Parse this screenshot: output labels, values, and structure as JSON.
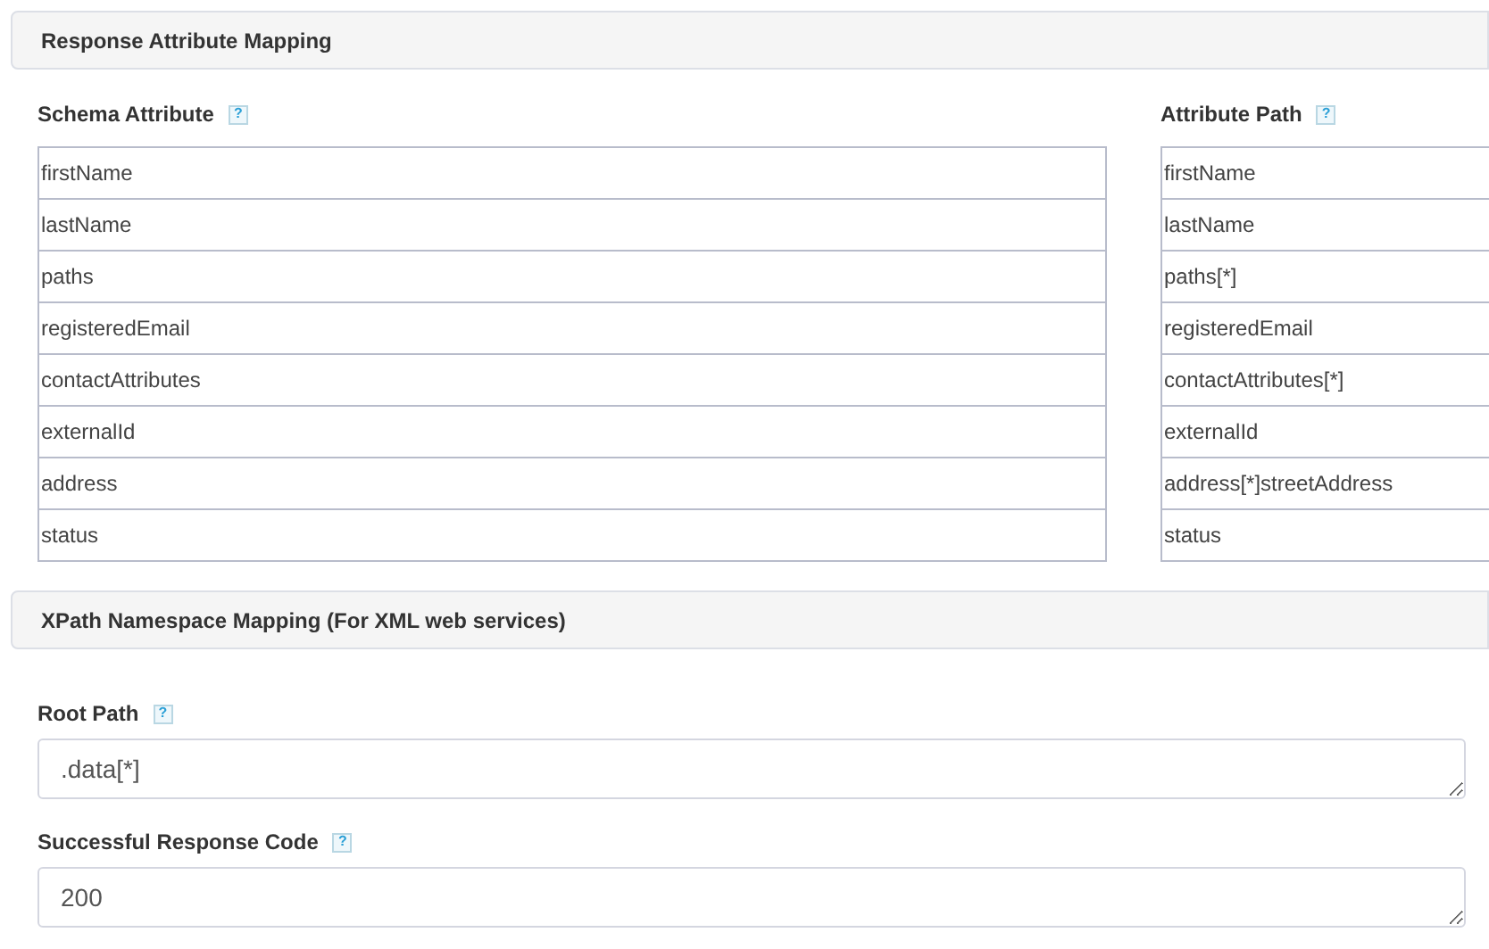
{
  "response_mapping": {
    "title": "Response Attribute Mapping",
    "columns": [
      {
        "label": "Schema Attribute",
        "help": "?"
      },
      {
        "label": "Attribute Path",
        "help": "?"
      }
    ],
    "rows": [
      {
        "schema_attribute": "firstName",
        "attribute_path": "firstName"
      },
      {
        "schema_attribute": "lastName",
        "attribute_path": "lastName"
      },
      {
        "schema_attribute": "paths",
        "attribute_path": "paths[*]"
      },
      {
        "schema_attribute": "registeredEmail",
        "attribute_path": "registeredEmail"
      },
      {
        "schema_attribute": "contactAttributes",
        "attribute_path": "contactAttributes[*]"
      },
      {
        "schema_attribute": "externalId",
        "attribute_path": "externalId"
      },
      {
        "schema_attribute": "address",
        "attribute_path": "address[*]streetAddress"
      },
      {
        "schema_attribute": "status",
        "attribute_path": "status"
      }
    ]
  },
  "xpath_mapping": {
    "title": "XPath Namespace Mapping (For XML web services)",
    "fields": [
      {
        "label": "Root Path",
        "help": "?",
        "value": ".data[*]"
      },
      {
        "label": "Successful Response Code",
        "help": "?",
        "value": "200"
      }
    ]
  }
}
